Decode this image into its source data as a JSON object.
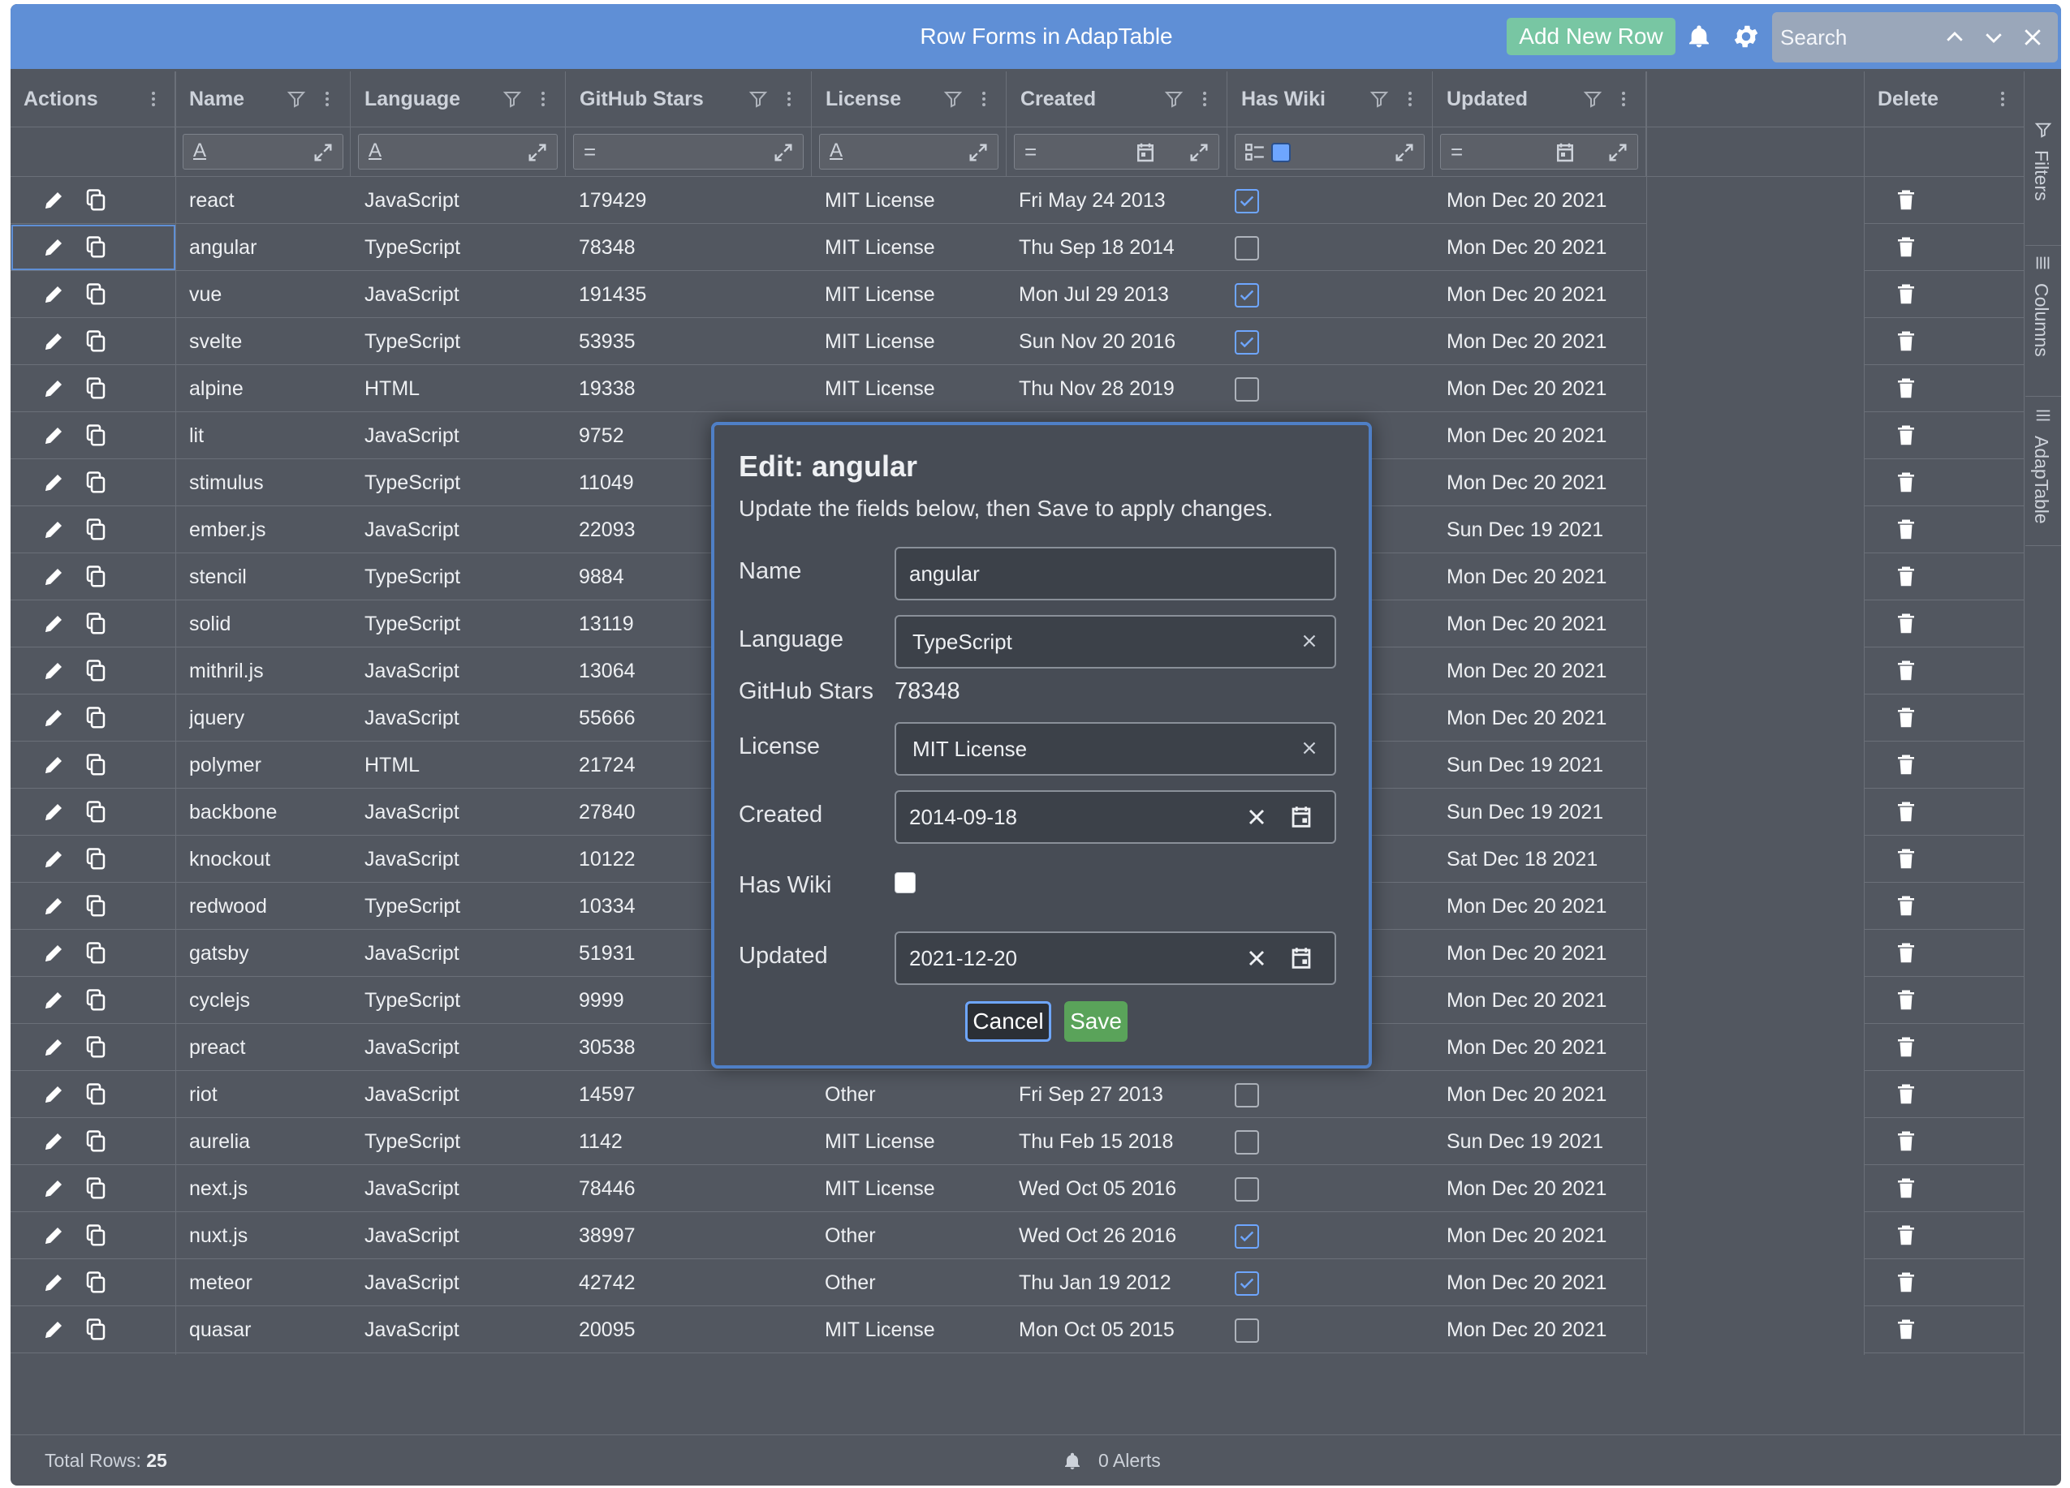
{
  "app": {
    "title": "Row Forms in AdapTable",
    "add_row_label": "Add New Row",
    "search": {
      "placeholder": "Search",
      "value": ""
    }
  },
  "columns": [
    {
      "label": "Actions"
    },
    {
      "label": "Name"
    },
    {
      "label": "Language"
    },
    {
      "label": "GitHub Stars"
    },
    {
      "label": "License"
    },
    {
      "label": "Created"
    },
    {
      "label": "Has Wiki"
    },
    {
      "label": "Updated"
    },
    {
      "label": "Delete"
    }
  ],
  "filters": {
    "name": "A",
    "language": "A",
    "stars": "=",
    "license": "A",
    "created": "=",
    "updated": "="
  },
  "rows": [
    {
      "name": "react",
      "language": "JavaScript",
      "stars": "179429",
      "license": "MIT License",
      "created": "Fri May 24 2013",
      "has_wiki": true,
      "updated": "Mon Dec 20 2021"
    },
    {
      "name": "angular",
      "language": "TypeScript",
      "stars": "78348",
      "license": "MIT License",
      "created": "Thu Sep 18 2014",
      "has_wiki": false,
      "updated": "Mon Dec 20 2021"
    },
    {
      "name": "vue",
      "language": "JavaScript",
      "stars": "191435",
      "license": "MIT License",
      "created": "Mon Jul 29 2013",
      "has_wiki": true,
      "updated": "Mon Dec 20 2021"
    },
    {
      "name": "svelte",
      "language": "TypeScript",
      "stars": "53935",
      "license": "MIT License",
      "created": "Sun Nov 20 2016",
      "has_wiki": true,
      "updated": "Mon Dec 20 2021"
    },
    {
      "name": "alpine",
      "language": "HTML",
      "stars": "19338",
      "license": "MIT License",
      "created": "Thu Nov 28 2019",
      "has_wiki": false,
      "updated": "Mon Dec 20 2021"
    },
    {
      "name": "lit",
      "language": "JavaScript",
      "stars": "9752",
      "license": "",
      "created": "",
      "has_wiki": null,
      "updated": "Mon Dec 20 2021"
    },
    {
      "name": "stimulus",
      "language": "TypeScript",
      "stars": "11049",
      "license": "",
      "created": "",
      "has_wiki": null,
      "updated": "Mon Dec 20 2021"
    },
    {
      "name": "ember.js",
      "language": "JavaScript",
      "stars": "22093",
      "license": "",
      "created": "",
      "has_wiki": null,
      "updated": "Sun Dec 19 2021"
    },
    {
      "name": "stencil",
      "language": "TypeScript",
      "stars": "9884",
      "license": "",
      "created": "",
      "has_wiki": null,
      "updated": "Mon Dec 20 2021"
    },
    {
      "name": "solid",
      "language": "TypeScript",
      "stars": "13119",
      "license": "",
      "created": "",
      "has_wiki": null,
      "updated": "Mon Dec 20 2021"
    },
    {
      "name": "mithril.js",
      "language": "JavaScript",
      "stars": "13064",
      "license": "",
      "created": "",
      "has_wiki": null,
      "updated": "Mon Dec 20 2021"
    },
    {
      "name": "jquery",
      "language": "JavaScript",
      "stars": "55666",
      "license": "",
      "created": "",
      "has_wiki": null,
      "updated": "Mon Dec 20 2021"
    },
    {
      "name": "polymer",
      "language": "HTML",
      "stars": "21724",
      "license": "",
      "created": "",
      "has_wiki": null,
      "updated": "Sun Dec 19 2021"
    },
    {
      "name": "backbone",
      "language": "JavaScript",
      "stars": "27840",
      "license": "",
      "created": "",
      "has_wiki": null,
      "updated": "Sun Dec 19 2021"
    },
    {
      "name": "knockout",
      "language": "JavaScript",
      "stars": "10122",
      "license": "",
      "created": "",
      "has_wiki": null,
      "updated": "Sat Dec 18 2021"
    },
    {
      "name": "redwood",
      "language": "TypeScript",
      "stars": "10334",
      "license": "",
      "created": "",
      "has_wiki": null,
      "updated": "Mon Dec 20 2021"
    },
    {
      "name": "gatsby",
      "language": "JavaScript",
      "stars": "51931",
      "license": "",
      "created": "",
      "has_wiki": null,
      "updated": "Mon Dec 20 2021"
    },
    {
      "name": "cyclejs",
      "language": "TypeScript",
      "stars": "9999",
      "license": "",
      "created": "",
      "has_wiki": null,
      "updated": "Mon Dec 20 2021"
    },
    {
      "name": "preact",
      "language": "JavaScript",
      "stars": "30538",
      "license": "",
      "created": "",
      "has_wiki": null,
      "updated": "Mon Dec 20 2021"
    },
    {
      "name": "riot",
      "language": "JavaScript",
      "stars": "14597",
      "license": "Other",
      "created": "Fri Sep 27 2013",
      "has_wiki": false,
      "updated": "Mon Dec 20 2021"
    },
    {
      "name": "aurelia",
      "language": "TypeScript",
      "stars": "1142",
      "license": "MIT License",
      "created": "Thu Feb 15 2018",
      "has_wiki": false,
      "updated": "Sun Dec 19 2021"
    },
    {
      "name": "next.js",
      "language": "JavaScript",
      "stars": "78446",
      "license": "MIT License",
      "created": "Wed Oct 05 2016",
      "has_wiki": false,
      "updated": "Mon Dec 20 2021"
    },
    {
      "name": "nuxt.js",
      "language": "JavaScript",
      "stars": "38997",
      "license": "Other",
      "created": "Wed Oct 26 2016",
      "has_wiki": true,
      "updated": "Mon Dec 20 2021"
    },
    {
      "name": "meteor",
      "language": "JavaScript",
      "stars": "42742",
      "license": "Other",
      "created": "Thu Jan 19 2012",
      "has_wiki": true,
      "updated": "Mon Dec 20 2021"
    },
    {
      "name": "quasar",
      "language": "JavaScript",
      "stars": "20095",
      "license": "MIT License",
      "created": "Mon Oct 05 2015",
      "has_wiki": false,
      "updated": "Mon Dec 20 2021"
    }
  ],
  "side_panel": {
    "filters": "Filters",
    "columns": "Columns",
    "adaptable": "AdapTable"
  },
  "status": {
    "total_rows_label": "Total Rows:",
    "total_rows": "25",
    "alerts": "0 Alerts"
  },
  "dialog": {
    "title": "Edit: angular",
    "subtitle": "Update the fields below, then Save to apply changes.",
    "name_label": "Name",
    "name_value": "angular",
    "language_label": "Language",
    "language_value": "TypeScript",
    "stars_label": "GitHub Stars",
    "stars_value": "78348",
    "license_label": "License",
    "license_value": "MIT License",
    "created_label": "Created",
    "created_value": "2014-09-18",
    "has_wiki_label": "Has Wiki",
    "has_wiki_value": false,
    "updated_label": "Updated",
    "updated_value": "2021-12-20",
    "cancel_label": "Cancel",
    "save_label": "Save"
  },
  "colors": {
    "title_bar": "#5f8fd6",
    "grid_bg": "#525760",
    "add_button": "#78c6a3",
    "save_button": "#5aa35a",
    "checkbox_checked": "#6ea6ff"
  }
}
